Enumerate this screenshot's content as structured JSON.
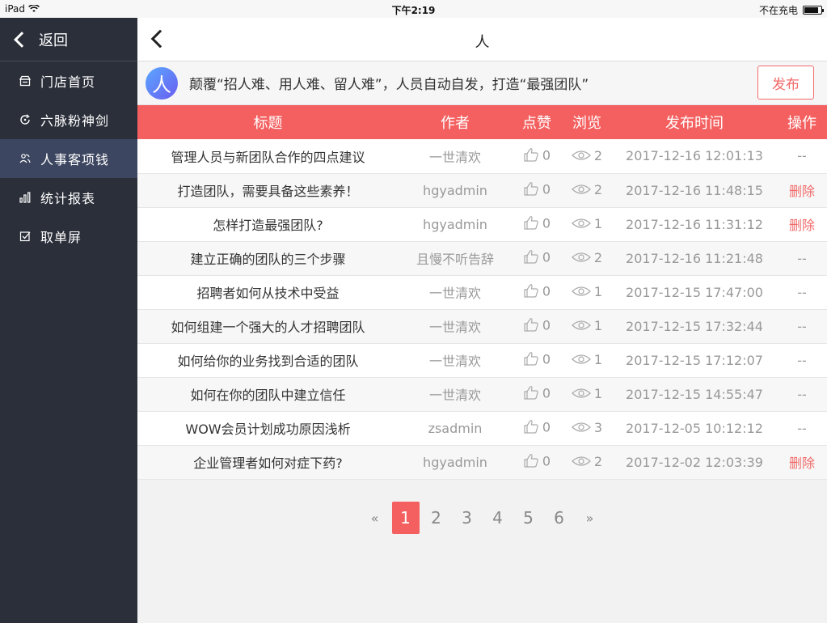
{
  "statusbar": {
    "device": "iPad",
    "time": "下午2:19",
    "charging": "不在充电"
  },
  "sidebar": {
    "back_label": "返回",
    "items": [
      {
        "label": "门店首页",
        "icon": "store-icon",
        "active": false
      },
      {
        "label": "六脉粉神剑",
        "icon": "refresh-icon",
        "active": false
      },
      {
        "label": "人事客项钱",
        "icon": "people-icon",
        "active": true
      },
      {
        "label": "统计报表",
        "icon": "bar-chart-icon",
        "active": false
      },
      {
        "label": "取单屏",
        "icon": "check-square-icon",
        "active": false
      }
    ]
  },
  "nav": {
    "title": "人"
  },
  "banner": {
    "avatar_char": "人",
    "text": "颠覆“招人难、用人难、留人难”，人员自动自发，打造“最强团队”",
    "publish_label": "发布"
  },
  "table": {
    "headers": [
      "标题",
      "作者",
      "点赞",
      "浏览",
      "发布时间",
      "操作"
    ],
    "rows": [
      {
        "title": "管理人员与新团队合作的四点建议",
        "author": "一世清欢",
        "likes": "0",
        "views": "2",
        "date": "2017-12-16 12:01:13",
        "op": "--"
      },
      {
        "title": "打造团队，需要具备这些素养！",
        "author": "hgyadmin",
        "likes": "0",
        "views": "2",
        "date": "2017-12-16 11:48:15",
        "op": "删除"
      },
      {
        "title": "怎样打造最强团队?",
        "author": "hgyadmin",
        "likes": "0",
        "views": "1",
        "date": "2017-12-16 11:31:12",
        "op": "删除"
      },
      {
        "title": "建立正确的团队的三个步骤",
        "author": "且慢不听告辞",
        "likes": "0",
        "views": "2",
        "date": "2017-12-16 11:21:48",
        "op": "--"
      },
      {
        "title": "招聘者如何从技术中受益",
        "author": "一世清欢",
        "likes": "0",
        "views": "1",
        "date": "2017-12-15 17:47:00",
        "op": "--"
      },
      {
        "title": "如何组建一个强大的人才招聘团队",
        "author": "一世清欢",
        "likes": "0",
        "views": "1",
        "date": "2017-12-15 17:32:44",
        "op": "--"
      },
      {
        "title": "如何给你的业务找到合适的团队",
        "author": "一世清欢",
        "likes": "0",
        "views": "1",
        "date": "2017-12-15 17:12:07",
        "op": "--"
      },
      {
        "title": "如何在你的团队中建立信任",
        "author": "一世清欢",
        "likes": "0",
        "views": "1",
        "date": "2017-12-15 14:55:47",
        "op": "--"
      },
      {
        "title": "WOW会员计划成功原因浅析",
        "author": "zsadmin",
        "likes": "0",
        "views": "3",
        "date": "2017-12-05 10:12:12",
        "op": "--"
      },
      {
        "title": "企业管理者如何对症下药?",
        "author": "hgyadmin",
        "likes": "0",
        "views": "2",
        "date": "2017-12-02 12:03:39",
        "op": "删除"
      }
    ]
  },
  "pager": {
    "prev": "«",
    "next": "»",
    "pages": [
      "1",
      "2",
      "3",
      "4",
      "5",
      "6"
    ],
    "current": "1"
  },
  "colors": {
    "accent": "#f46060",
    "sidebar_bg": "#2b2f3a",
    "sidebar_active": "#3d4660"
  }
}
